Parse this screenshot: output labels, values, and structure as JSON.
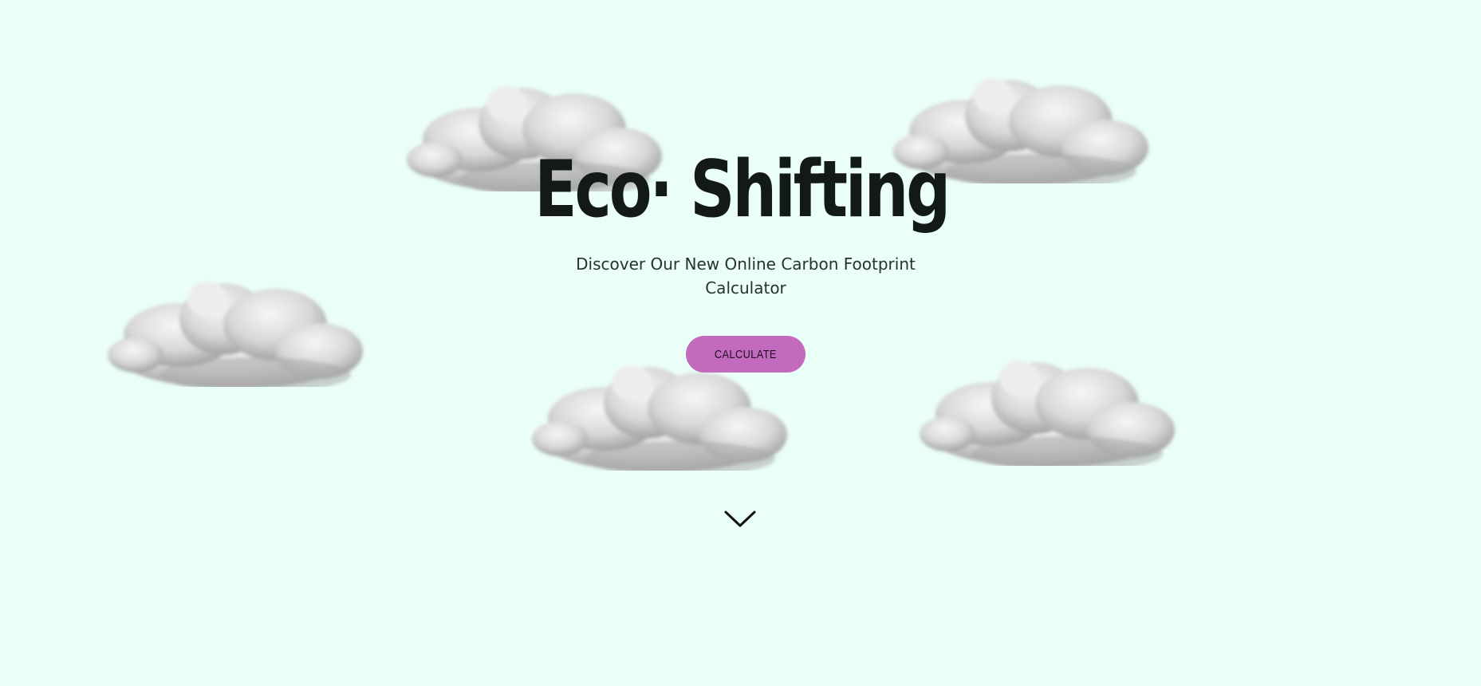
{
  "hero": {
    "title": "Eco· Shifting",
    "subtitle": "Discover Our New Online Carbon Footprint Calculator",
    "cta_label": "CALCULATE"
  },
  "icons": {
    "scroll": "chevron-down-icon",
    "clouds": "cloud-icon"
  },
  "colors": {
    "background": "#eafff7",
    "title": "#131818",
    "button": "#c26bbe",
    "button_text": "#1e0e1d",
    "cloud": "#c9c9c9"
  }
}
